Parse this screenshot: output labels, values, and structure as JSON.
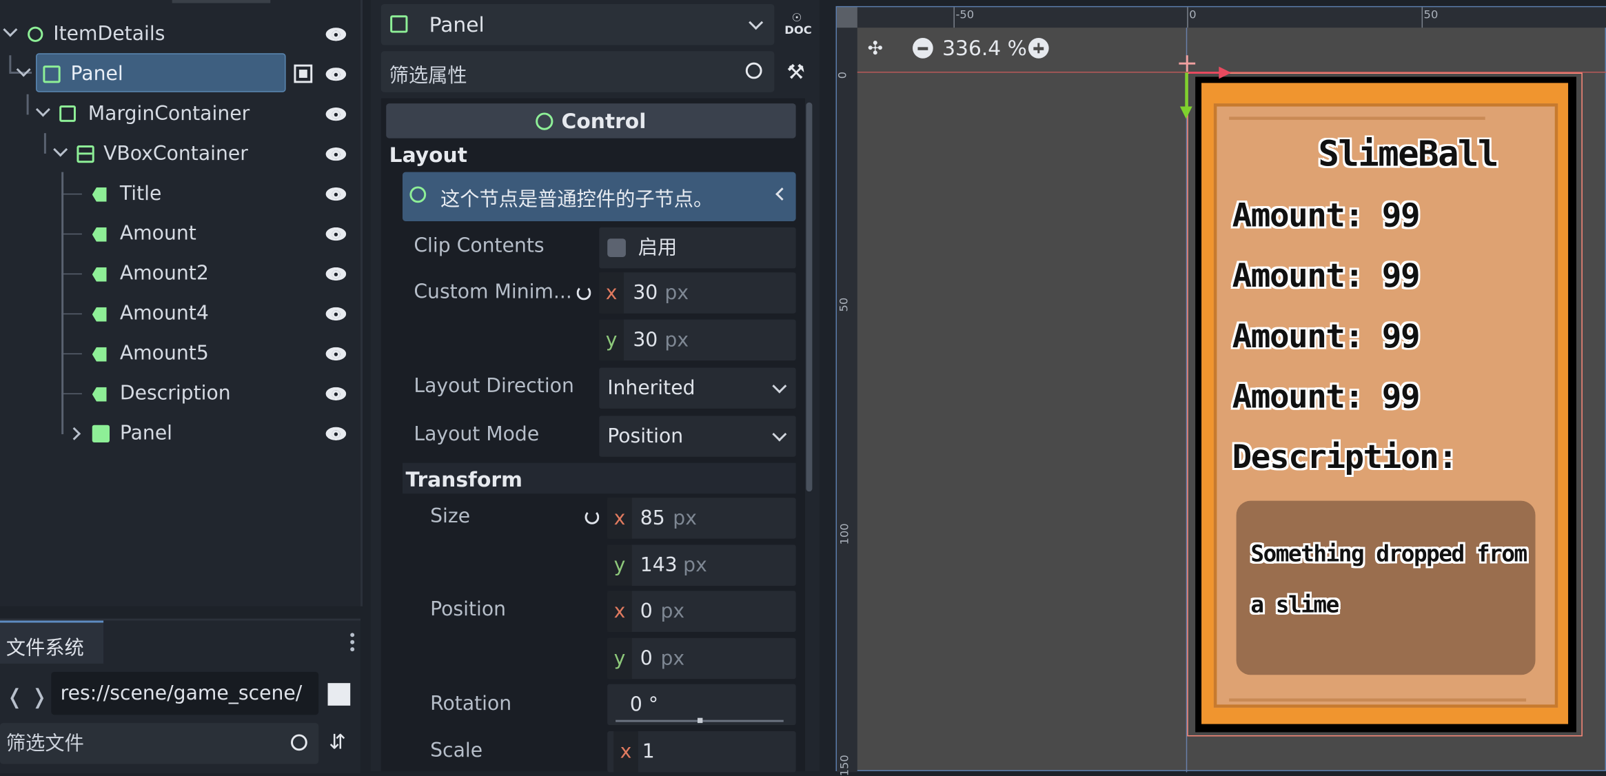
{
  "scene_tree": {
    "nodes": [
      {
        "label": "ItemDetails",
        "icon": "control-node-icon"
      },
      {
        "label": "Panel",
        "icon": "panel-node-icon",
        "selected": true
      },
      {
        "label": "MarginContainer",
        "icon": "margin-container-icon"
      },
      {
        "label": "VBoxContainer",
        "icon": "vbox-container-icon"
      },
      {
        "label": "Title",
        "icon": "label-node-icon"
      },
      {
        "label": "Amount",
        "icon": "label-node-icon"
      },
      {
        "label": "Amount2",
        "icon": "label-node-icon"
      },
      {
        "label": "Amount4",
        "icon": "label-node-icon"
      },
      {
        "label": "Amount5",
        "icon": "label-node-icon"
      },
      {
        "label": "Description",
        "icon": "label-node-icon"
      },
      {
        "label": "Panel",
        "icon": "panel-filled-icon"
      }
    ]
  },
  "filesystem": {
    "tab_label": "文件系统",
    "path": "res://scene/game_scene/",
    "filter_placeholder": "筛选文件"
  },
  "inspector": {
    "node_name": "Panel",
    "filter_placeholder": "筛选属性",
    "class_header": "Control",
    "layout_section": "Layout",
    "info_text": "这个节点是普通控件的子节点。",
    "clip_contents": {
      "label": "Clip Contents",
      "value": "启用",
      "checked": false
    },
    "custom_min": {
      "label": "Custom Minim...",
      "x": "30",
      "y": "30",
      "unit": "px"
    },
    "layout_direction": {
      "label": "Layout Direction",
      "value": "Inherited"
    },
    "layout_mode": {
      "label": "Layout Mode",
      "value": "Position"
    },
    "transform_section": "Transform",
    "size": {
      "label": "Size",
      "x": "85",
      "y": "143",
      "unit": "px"
    },
    "position": {
      "label": "Position",
      "x": "0",
      "y": "0",
      "unit": "px"
    },
    "rotation": {
      "label": "Rotation",
      "value": "0 °"
    },
    "scale": {
      "label": "Scale",
      "x": "1"
    }
  },
  "viewport": {
    "zoom": "336.4 %",
    "ruler_top": [
      "-50",
      "0",
      "50"
    ],
    "ruler_left": [
      "0",
      "50",
      "100",
      "150"
    ],
    "card": {
      "title": "SlimeBall",
      "amount_lines": [
        "Amount: 99",
        "Amount: 99",
        "Amount: 99",
        "Amount: 99"
      ],
      "description_label": "Description:",
      "description_text_1": "Something dropped from",
      "description_text_2": "a slime"
    }
  }
}
